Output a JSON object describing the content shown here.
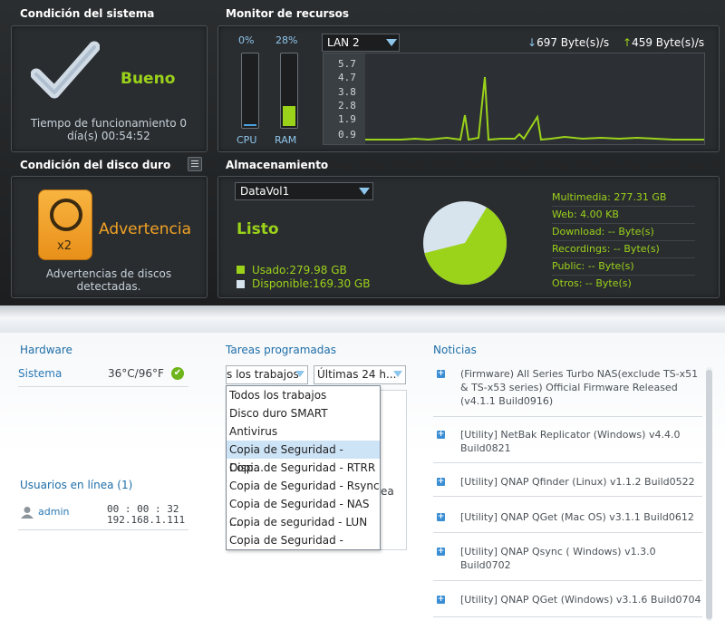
{
  "system": {
    "title": "Condición del sistema",
    "status": "Bueno",
    "uptime_line1": "Tiempo de funcionamiento 0",
    "uptime_line2": "día(s) 00:54:52"
  },
  "resource": {
    "title": "Monitor de recursos",
    "cpu_label": "CPU",
    "cpu_value": "0%",
    "cpu_fill": 0.03,
    "ram_label": "RAM",
    "ram_value": "28%",
    "ram_fill": 0.28,
    "lan_select": "LAN 2",
    "download": "697 Byte(s)/s",
    "upload": "459 Byte(s)/s",
    "ticks": [
      "5.7",
      "4.7",
      "3.8",
      "2.8",
      "1.9",
      "0.9"
    ]
  },
  "disk": {
    "title": "Condición del disco duro",
    "badge": "x2",
    "status": "Advertencia",
    "msg_line1": "Advertencias de discos",
    "msg_line2": "detectadas."
  },
  "storage": {
    "title": "Almacenamiento",
    "volume": "DataVol1",
    "status": "Listo",
    "used": "Usado:279.98 GB",
    "free": "Disponible:169.30 GB",
    "used_fraction": 0.623,
    "shares": [
      "Multimedia: 277.31 GB",
      "Web: 4.00 KB",
      "Download: -- Byte(s)",
      "Recordings: -- Byte(s)",
      "Public: -- Byte(s)",
      "Otros: -- Byte(s)"
    ]
  },
  "colors": {
    "accent_green": "#9bd21a",
    "warning_orange": "#f0a224",
    "link_blue": "#1e6ea8"
  },
  "hardware": {
    "title": "Hardware",
    "sistema_label": "Sistema",
    "temp": "36°C/96°F"
  },
  "users": {
    "title": "Usuarios en línea (1)",
    "name": "admin",
    "time": "00 : 00 : 32",
    "ip": "192.168.1.111"
  },
  "tasks": {
    "title": "Tareas programadas",
    "select1": "s los trabajos",
    "select2": "Últimas 24 h...",
    "behind_text": "ea",
    "options": [
      "Todos los trabajos",
      "Disco duro SMART",
      "Antivirus",
      "Copia de Seguridad - Disp...",
      "Copia de Seguridad - RTRR",
      "Copia de Seguridad - Rsync",
      "Copia de Seguridad - NAS ...",
      "Copia de seguridad - LUN",
      "Copia de Seguridad - Ama..."
    ]
  },
  "news": {
    "title": "Noticias",
    "items": [
      [
        "(Firmware) All Series Turbo NAS(exclude TS-x51",
        "& TS-x53 series) Official Firmware Released",
        "(v4.1.1 Build0916)"
      ],
      [
        "[Utility] NetBak Replicator (Windows) v4.4.0",
        "Build0821"
      ],
      [
        "[Utility] QNAP Qfinder (Linux) v1.1.2 Build0522"
      ],
      [
        "[Utility] QNAP QGet (Mac OS) v3.1.1 Build0612"
      ],
      [
        "[Utility] QNAP Qsync ( Windows) v1.3.0",
        "Build0702"
      ],
      [
        "[Utility] QNAP QGet (Windows) v3.1.6 Build0704"
      ]
    ]
  }
}
